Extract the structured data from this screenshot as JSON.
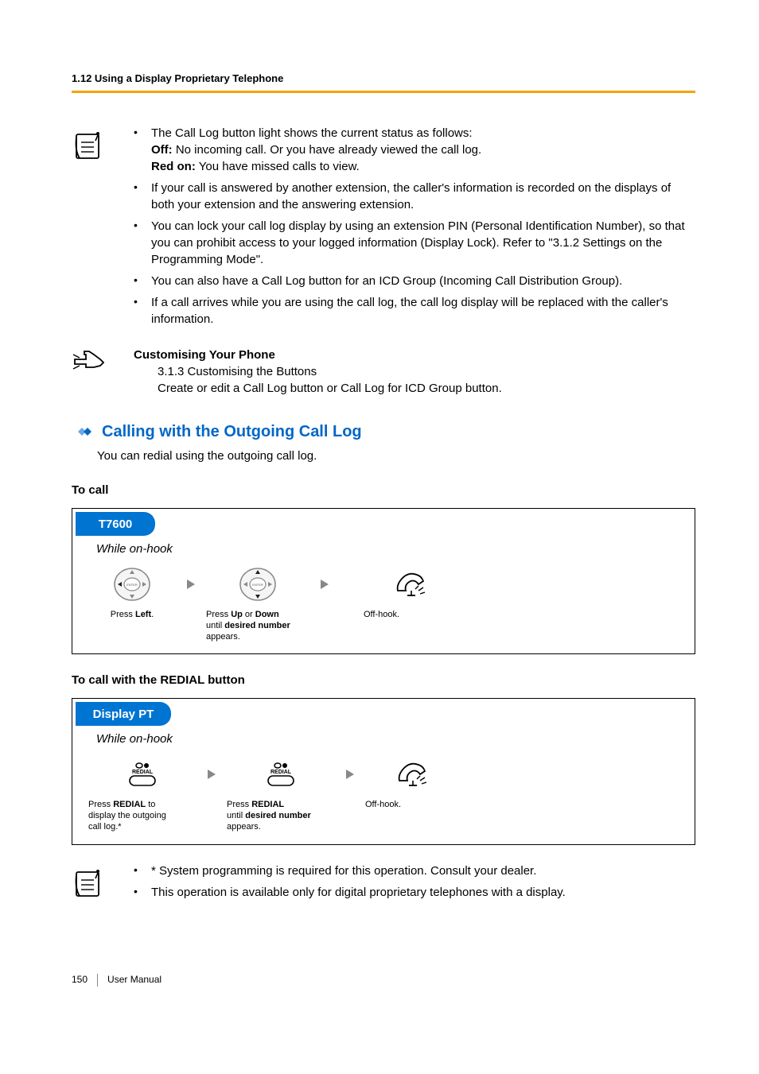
{
  "header": {
    "section": "1.12 Using a Display Proprietary Telephone"
  },
  "notes": {
    "items": [
      {
        "prefix": "The Call Log button light shows the current status as follows:",
        "sub": [
          {
            "label": "Off:",
            "text": " No incoming call. Or you have already viewed the call log."
          },
          {
            "label": "Red on:",
            "text": " You have missed calls to view."
          }
        ]
      },
      {
        "text": "If your call is answered by another extension, the caller's information is recorded on the displays of both your extension and the answering extension."
      },
      {
        "text": "You can lock your call log display by using an extension PIN (Personal Identification Number), so that you can prohibit access to your logged information (Display Lock). Refer to \"3.1.2 Settings on the Programming Mode\"."
      },
      {
        "text": "You can also have a Call Log button for an ICD Group (Incoming Call Distribution Group)."
      },
      {
        "text": "If a call arrives while you are using the call log, the call log display will be replaced with the caller's information."
      }
    ]
  },
  "customise": {
    "title": "Customising Your Phone",
    "line1": "3.1.3 Customising the Buttons",
    "line2": "Create or edit a Call Log button or Call Log for ICD Group button."
  },
  "heading": {
    "title": "Calling with the Outgoing Call Log",
    "intro": "You can redial using the outgoing call log."
  },
  "proc1": {
    "label": "To call",
    "tab": "T7600",
    "state": "While on-hook",
    "step1_pre": "Press ",
    "step1_bold": "Left",
    "step1_post": ".",
    "step2_pre": "Press ",
    "step2_bold1": "Up",
    "step2_mid": " or ",
    "step2_bold2": "Down",
    "step2_line2_pre": "until ",
    "step2_line2_bold": "desired number",
    "step2_line3": "appears.",
    "step3": "Off-hook."
  },
  "proc2": {
    "label": "To call with the REDIAL button",
    "tab": "Display PT",
    "state": "While on-hook",
    "btn_label": "REDIAL",
    "step1_pre": "Press ",
    "step1_bold": "REDIAL",
    "step1_post": " to",
    "step1_line2": "display the outgoing",
    "step1_line3": "call log.*",
    "step2_pre": "Press ",
    "step2_bold": "REDIAL",
    "step2_line2_pre": "until ",
    "step2_line2_bold": "desired number",
    "step2_line3": "appears.",
    "step3": "Off-hook."
  },
  "footnotes": {
    "items": [
      "* System programming is required for this operation. Consult your dealer.",
      "This operation is available only for digital proprietary telephones with a display."
    ]
  },
  "footer": {
    "page": "150",
    "label": "User Manual"
  }
}
